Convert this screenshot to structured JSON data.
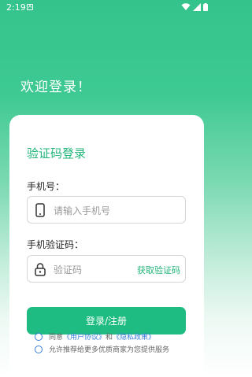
{
  "status_bar": {
    "time": "2:19",
    "notif": "A"
  },
  "welcome": "欢迎登录！",
  "card": {
    "title": "验证码登录",
    "phone_label": "手机号：",
    "phone_placeholder": "请输入手机号",
    "code_label": "手机验证码：",
    "code_placeholder": "验证码",
    "get_code": "获取验证码",
    "login_button": "登录/注册",
    "agree_prefix": "同意",
    "user_agreement": "《用户协议》",
    "and": "和",
    "privacy_policy": "《隐私政策》",
    "recommend_text": "允许推荐给更多优质商家为您提供服务"
  },
  "colors": {
    "accent": "#1ebc82",
    "link": "#3b7dd8"
  }
}
